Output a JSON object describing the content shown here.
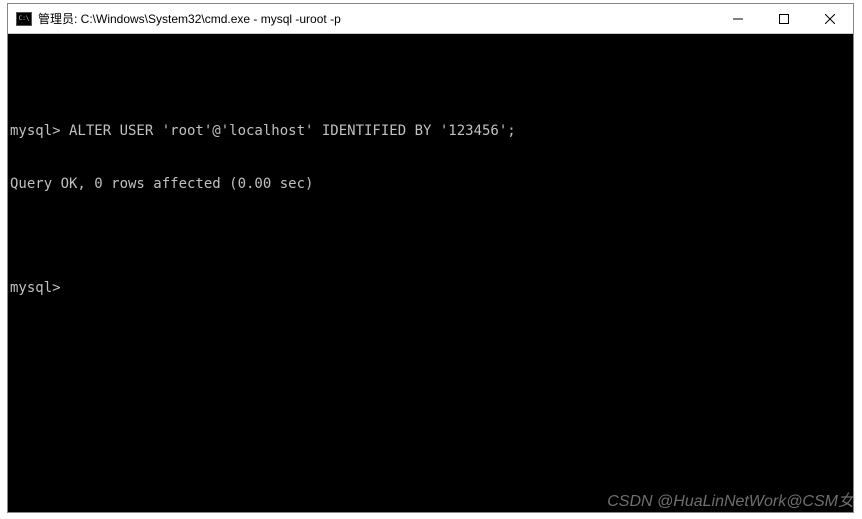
{
  "window": {
    "title": "管理员: C:\\Windows\\System32\\cmd.exe - mysql  -uroot -p"
  },
  "terminal": {
    "line1": "mysql> ALTER USER 'root'@'localhost' IDENTIFIED BY '123456';",
    "line2": "Query OK, 0 rows affected (0.00 sec)",
    "line3": "",
    "line4": "mysql>"
  },
  "watermark": "CSDN @HuaLinNetWork@CSM女"
}
